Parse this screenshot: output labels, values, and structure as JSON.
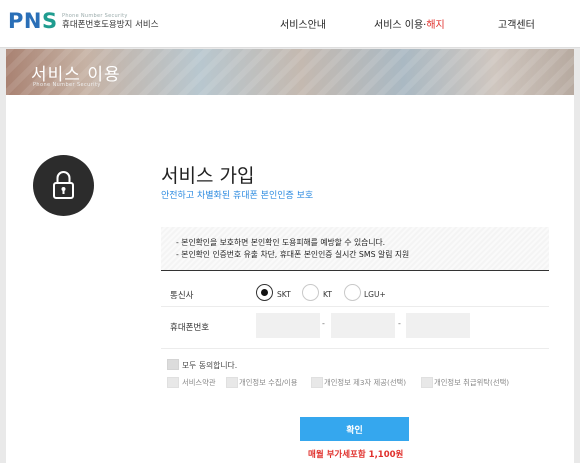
{
  "header": {
    "logo_text_pn": "PN",
    "logo_text_s": "S",
    "logo_en": "Phone Number Security",
    "logo_ko": "휴대폰번호도용방지 서비스",
    "nav": {
      "service_info": "서비스안내",
      "service_use_a": "서비스 이용·",
      "service_use_b": "해지",
      "customer_center": "고객센터"
    }
  },
  "banner": {
    "title": "서비스 이용",
    "subtitle": "Phone Number Security"
  },
  "main": {
    "title": "서비스 가입",
    "subtitle": "안전하고 차별화된 휴대폰 본인인증 보호",
    "notice": [
      "- 본인확인을 보호하면 본인확인 도용피해를 예방할 수 있습니다.",
      "- 본인확인 인증번호 유출 차단, 휴대폰 본인인증 실시간 SMS 알림 지원"
    ],
    "carrier": {
      "label": "통신사",
      "options": [
        "SKT",
        "KT",
        "LGU+"
      ],
      "selected": "SKT"
    },
    "phone": {
      "label": "휴대폰번호",
      "sep": "-",
      "values": [
        "",
        "",
        ""
      ]
    },
    "agree": {
      "all_label": "모두 동의합니다.",
      "items": [
        "서비스약관",
        "개인정보 수집/이용",
        "개인정보 제3자 제공(선택)",
        "개인정보 취급위탁(선택)"
      ]
    },
    "confirm_label": "확인",
    "price_text": "매월 부가세포함 1,100원"
  },
  "colors": {
    "brand_blue": "#2a6fb7",
    "accent_red": "#e0302c",
    "button_blue": "#35a7ee",
    "link_blue": "#2d8be0"
  }
}
